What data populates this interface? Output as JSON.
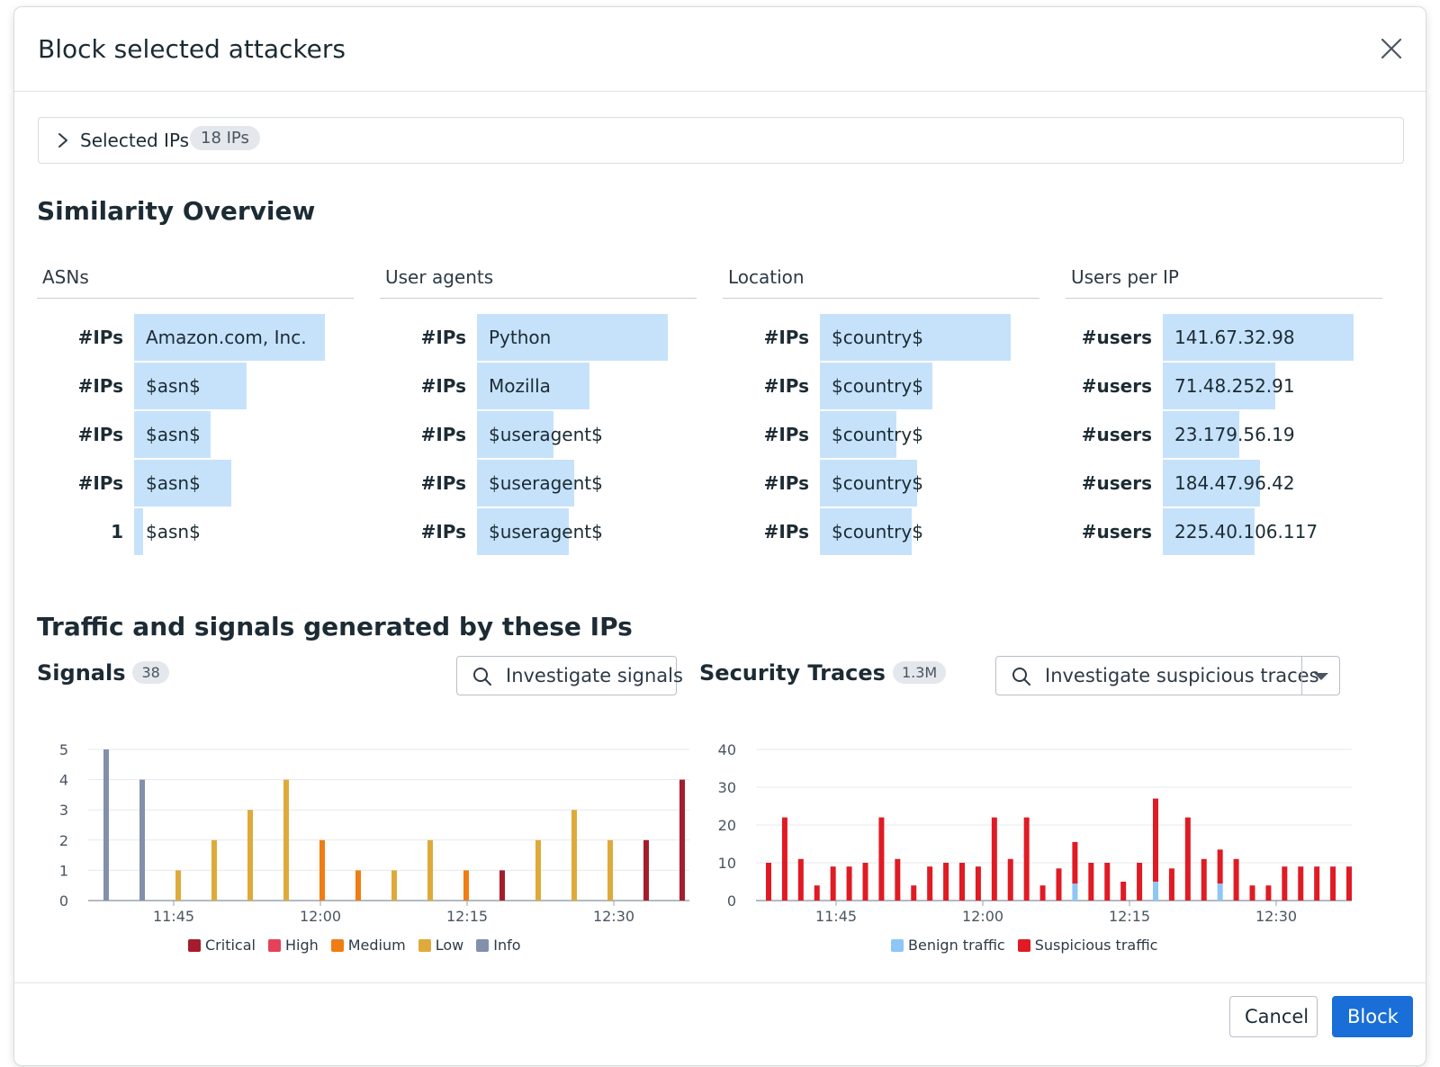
{
  "modal": {
    "title": "Block selected attackers"
  },
  "selected_ips": {
    "label": "Selected IPs",
    "count": "18 IPs"
  },
  "similarity": {
    "title": "Similarity Overview",
    "columns": [
      {
        "header": "ASNs",
        "rows": [
          {
            "count": "#IPs",
            "label": "Amazon.com, Inc.",
            "fill": 1.0
          },
          {
            "count": "#IPs",
            "label": "$asn$",
            "fill": 0.59
          },
          {
            "count": "#IPs",
            "label": "$asn$",
            "fill": 0.4
          },
          {
            "count": "#IPs",
            "label": "$asn$",
            "fill": 0.51
          },
          {
            "count": "1",
            "label": "$asn$",
            "fill": 0.04
          }
        ]
      },
      {
        "header": "User agents",
        "rows": [
          {
            "count": "#IPs",
            "label": "Python",
            "fill": 1.0
          },
          {
            "count": "#IPs",
            "label": "Mozilla",
            "fill": 0.59
          },
          {
            "count": "#IPs",
            "label": "$useragent$",
            "fill": 0.4
          },
          {
            "count": "#IPs",
            "label": "$useragent$",
            "fill": 0.51
          },
          {
            "count": "#IPs",
            "label": "$useragent$",
            "fill": 0.48
          }
        ]
      },
      {
        "header": "Location",
        "rows": [
          {
            "count": "#IPs",
            "label": "$country$",
            "fill": 1.0
          },
          {
            "count": "#IPs",
            "label": "$country$",
            "fill": 0.59
          },
          {
            "count": "#IPs",
            "label": "$country$",
            "fill": 0.4
          },
          {
            "count": "#IPs",
            "label": "$country$",
            "fill": 0.51
          },
          {
            "count": "#IPs",
            "label": "$country$",
            "fill": 0.48
          }
        ]
      },
      {
        "header": "Users per IP",
        "rows": [
          {
            "count": "#users",
            "label": "141.67.32.98",
            "fill": 1.0
          },
          {
            "count": "#users",
            "label": "71.48.252.91",
            "fill": 0.59
          },
          {
            "count": "#users",
            "label": "23.179.56.19",
            "fill": 0.4
          },
          {
            "count": "#users",
            "label": "184.47.96.42",
            "fill": 0.51
          },
          {
            "count": "#users",
            "label": "225.40.106.117",
            "fill": 0.48
          }
        ]
      }
    ]
  },
  "traffic": {
    "title": "Traffic and signals generated by these IPs",
    "signals": {
      "title": "Signals",
      "count": "38",
      "button": "Investigate signals"
    },
    "traces": {
      "title": "Security Traces",
      "count": "1.3M",
      "button": "Investigate suspicious traces"
    }
  },
  "footer": {
    "cancel": "Cancel",
    "block": "Block"
  },
  "chart_data": [
    {
      "type": "bar",
      "stacked": false,
      "ylim": [
        0,
        5
      ],
      "yticks": [
        0,
        1,
        2,
        3,
        4,
        5
      ],
      "xticks": [
        "11:45",
        "12:00",
        "12:15",
        "12:30"
      ],
      "legend_position": "bottom",
      "colors": {
        "Critical": "#a51d2d",
        "High": "#e5425a",
        "Medium": "#f07d14",
        "Low": "#deaa3a",
        "Info": "#8290ab"
      },
      "legend": [
        "Critical",
        "High",
        "Medium",
        "Low",
        "Info"
      ],
      "bars": [
        {
          "series": "Info",
          "value": 5
        },
        {
          "series": "Info",
          "value": 4
        },
        {
          "series": "Low",
          "value": 1
        },
        {
          "series": "Low",
          "value": 2
        },
        {
          "series": "Low",
          "value": 3
        },
        {
          "series": "Low",
          "value": 4
        },
        {
          "series": "Medium",
          "value": 2
        },
        {
          "series": "Medium",
          "value": 1
        },
        {
          "series": "Low",
          "value": 1
        },
        {
          "series": "Low",
          "value": 2
        },
        {
          "series": "Medium",
          "value": 1
        },
        {
          "series": "Critical",
          "value": 1
        },
        {
          "series": "Low",
          "value": 2
        },
        {
          "series": "Low",
          "value": 3
        },
        {
          "series": "Low",
          "value": 2
        },
        {
          "series": "Critical",
          "value": 2
        },
        {
          "series": "Critical",
          "value": 4
        }
      ]
    },
    {
      "type": "bar",
      "stacked": true,
      "ylim": [
        0,
        40
      ],
      "yticks": [
        0,
        10,
        20,
        30,
        40
      ],
      "xticks": [
        "11:45",
        "12:00",
        "12:15",
        "12:30"
      ],
      "legend_position": "bottom",
      "colors": {
        "Benign traffic": "#8ec6f5",
        "Suspicious traffic": "#e01b24"
      },
      "legend": [
        "Benign traffic",
        "Suspicious traffic"
      ],
      "series": [
        {
          "name": "Benign traffic",
          "values": [
            0,
            0,
            0,
            0,
            0,
            0,
            0,
            0,
            0,
            0,
            0,
            0,
            0,
            0,
            0,
            0,
            0,
            0,
            0,
            4.5,
            0,
            0,
            0,
            0,
            5,
            0,
            0,
            0,
            4.5,
            0,
            0,
            0,
            0,
            0,
            0,
            0,
            0
          ]
        },
        {
          "name": "Suspicious traffic",
          "values": [
            10,
            22,
            11,
            4,
            9,
            9,
            10,
            22,
            11,
            4,
            9,
            10,
            10,
            9,
            22,
            11,
            22,
            4,
            8.5,
            11,
            10,
            10,
            5,
            10,
            22,
            8.5,
            22,
            11,
            9,
            11,
            4,
            4,
            9,
            9,
            9,
            9,
            9
          ]
        }
      ]
    }
  ]
}
